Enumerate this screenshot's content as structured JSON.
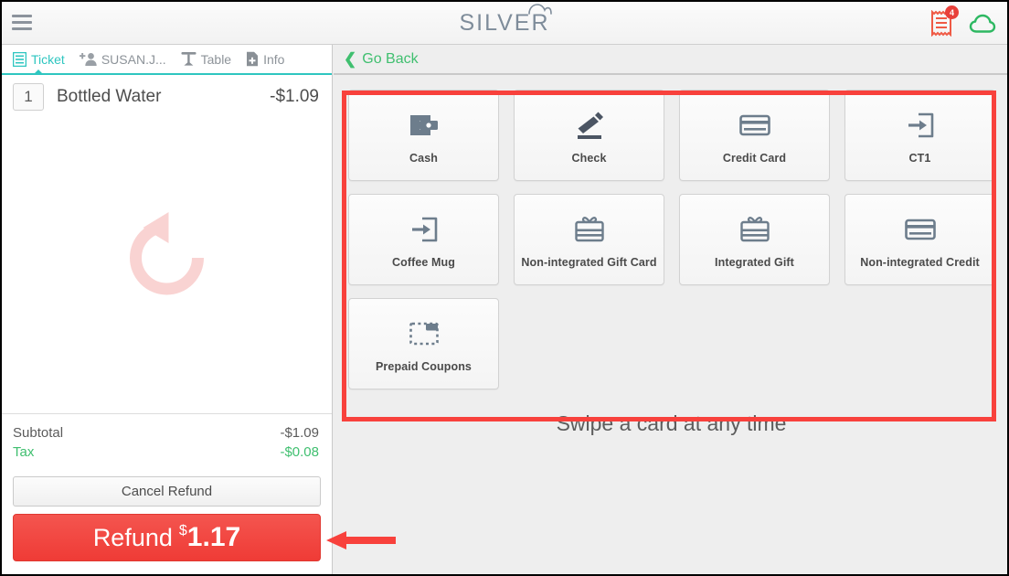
{
  "header": {
    "menu_icon": "hamburger-menu-icon",
    "logo_text": "SILVER",
    "logo_cloud_icon": "cloud-arc-icon",
    "receipt_icon": "receipt-icon",
    "receipt_badge_count": "4",
    "cloud_icon": "cloud-icon",
    "badge_color": "#e8403a",
    "cloud_color": "#3fbf6f",
    "receipt_color": "#ef5a45"
  },
  "ticket": {
    "tabs": [
      {
        "label": "Ticket",
        "icon": "ticket-list-icon",
        "active": true
      },
      {
        "label": "SUSAN.J...",
        "icon": "add-person-icon",
        "active": false
      },
      {
        "label": "Table",
        "icon": "table-icon",
        "active": false
      },
      {
        "label": "Info",
        "icon": "file-add-icon",
        "active": false
      }
    ],
    "items": [
      {
        "qty": "1",
        "name": "Bottled Water",
        "price": "-$1.09"
      }
    ],
    "watermark_icon": "refund-rotate-arrow-icon",
    "totals": [
      {
        "label": "Subtotal",
        "value": "-$1.09"
      },
      {
        "label": "Tax",
        "value": "-$0.08"
      }
    ],
    "cancel_label": "Cancel Refund",
    "refund_word": "Refund",
    "refund_currency": "$",
    "refund_amount": "1.17",
    "accent_teal": "#2ec6c0",
    "green": "#3fbf6f",
    "refund_red": "#ef3b36"
  },
  "payment": {
    "go_back_label": "Go Back",
    "methods": [
      {
        "label": "Cash",
        "icon": "wallet-icon"
      },
      {
        "label": "Check",
        "icon": "pencil-icon"
      },
      {
        "label": "Credit Card",
        "icon": "credit-card-icon"
      },
      {
        "label": "CT1",
        "icon": "arrow-into-box-icon"
      },
      {
        "label": "Coffee Mug",
        "icon": "arrow-into-box-icon"
      },
      {
        "label": "Non-integrated Gift Card",
        "icon": "gift-card-icon"
      },
      {
        "label": "Integrated Gift",
        "icon": "gift-card-icon"
      },
      {
        "label": "Non-integrated Credit",
        "icon": "credit-card-icon"
      },
      {
        "label": "Prepaid Coupons",
        "icon": "dashed-coupon-icon"
      }
    ],
    "swipe_message": "Swipe a card at any time"
  },
  "annotations": {
    "highlight_box_color": "#f8413c",
    "arrow_color": "#f8413c",
    "arrow_icon": "left-pointing-arrow-annotation"
  }
}
